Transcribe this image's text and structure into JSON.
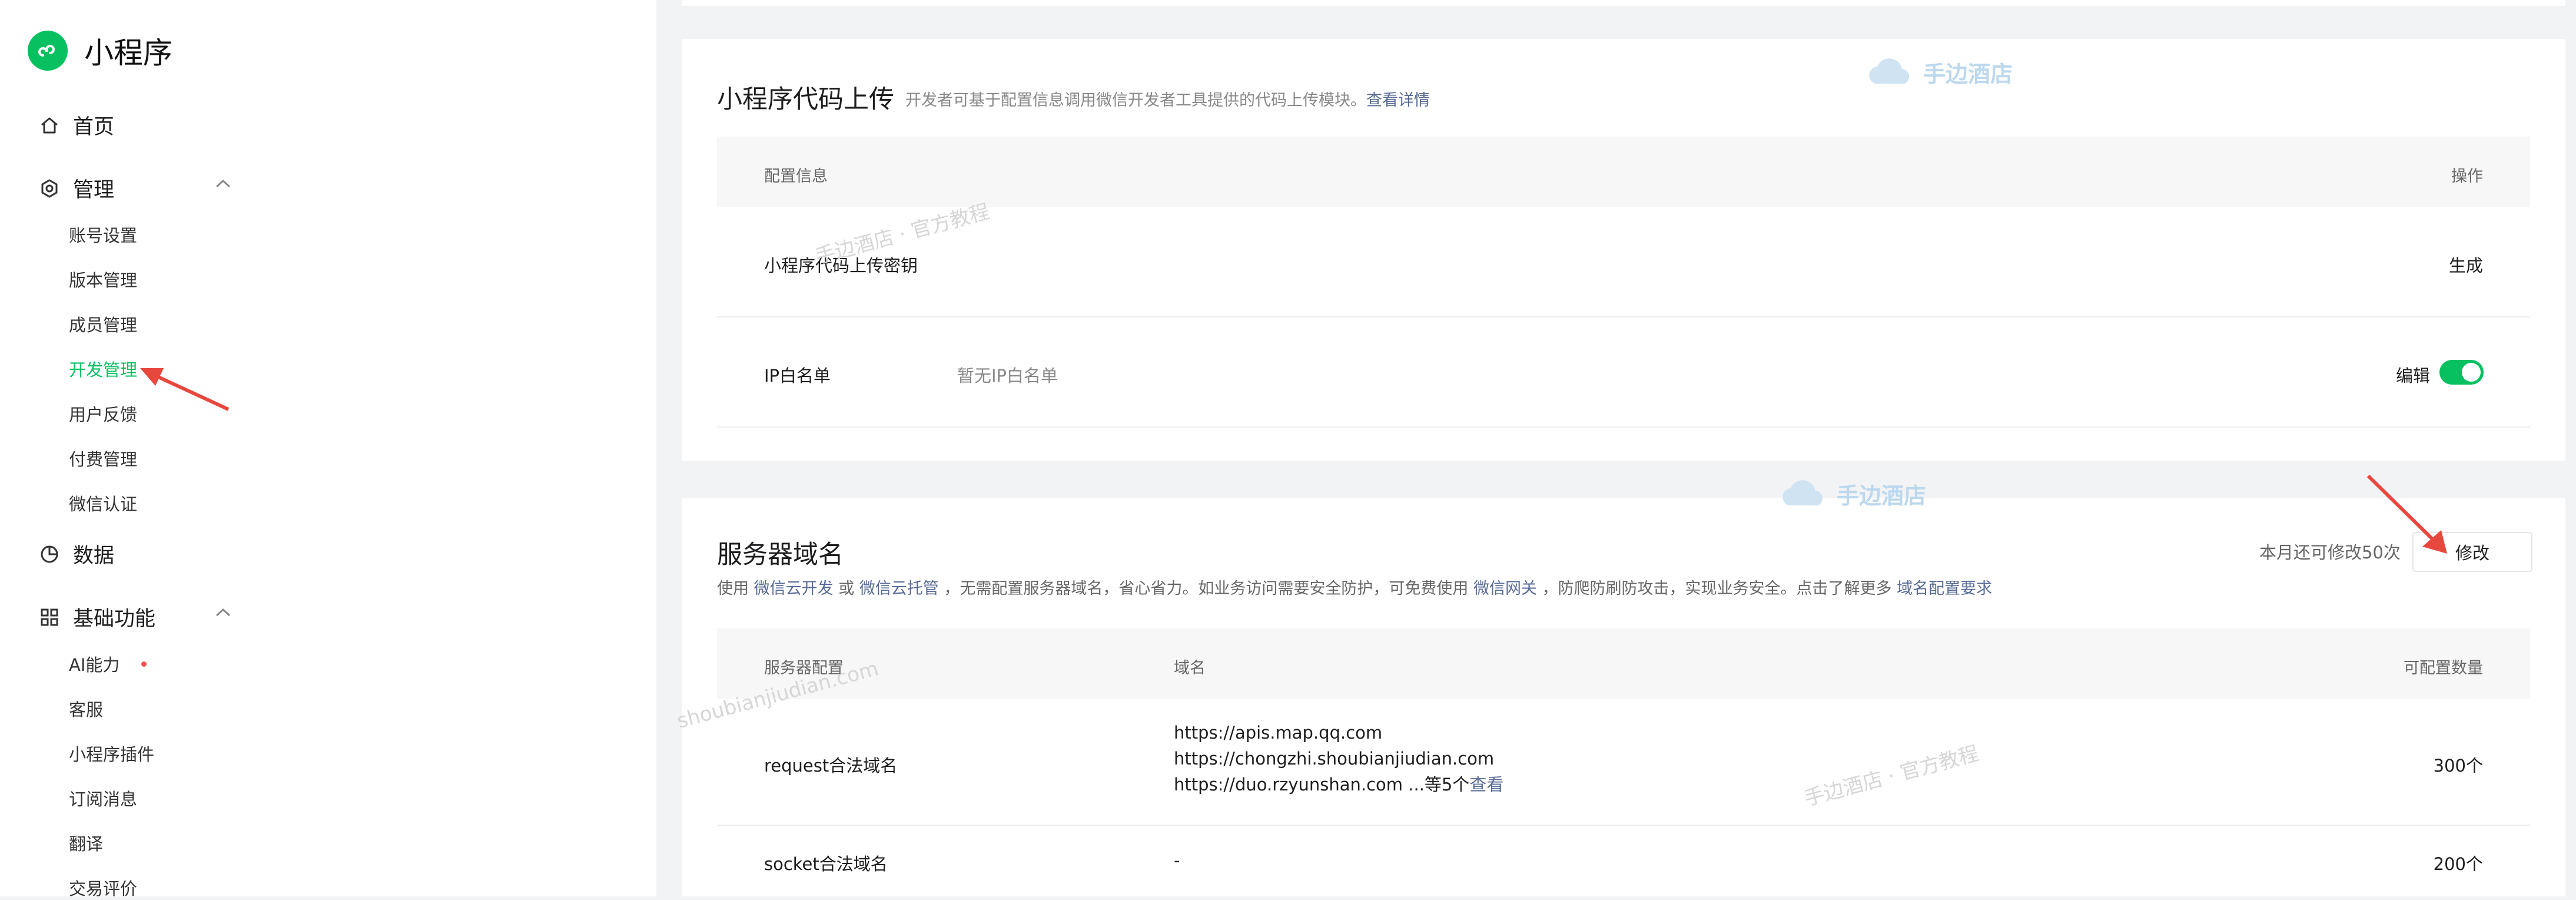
{
  "app": {
    "title": "小程序",
    "brand_color": "#07c160",
    "link_color": "#576b95"
  },
  "sidebar": {
    "home": "首页",
    "manage": {
      "label": "管理",
      "items": [
        "账号设置",
        "版本管理",
        "成员管理",
        "开发管理",
        "用户反馈",
        "付费管理",
        "微信认证"
      ],
      "active_item": "开发管理"
    },
    "data": "数据",
    "basic": {
      "label": "基础功能",
      "items": [
        "AI能力",
        "客服",
        "小程序插件",
        "订阅消息",
        "翻译",
        "交易评价"
      ]
    }
  },
  "upload_card": {
    "title": "小程序代码上传",
    "hint": "开发者可基于配置信息调用微信开发者工具提供的代码上传模块。",
    "hint_link": "查看详情",
    "columns": {
      "config": "配置信息",
      "action": "操作"
    },
    "rows": [
      {
        "label": "小程序代码上传密钥",
        "value": "",
        "action": "生成"
      },
      {
        "label": "IP白名单",
        "value": "暂无IP白名单",
        "action": "编辑",
        "toggle_on": true
      }
    ]
  },
  "domain_card": {
    "title": "服务器域名",
    "quota_text": "本月还可修改50次",
    "modify_button": "修改",
    "desc": {
      "p1": "使用",
      "l1": "微信云开发",
      "p2": "或",
      "l2": "微信云托管",
      "p3": "，无需配置服务器域名，省心省力。如业务访问需要安全防护，可免费使用",
      "l3": "微信网关",
      "p4": "，防爬防刷防攻击，实现业务安全。点击了解更多",
      "l4": "域名配置要求"
    },
    "columns": {
      "config": "服务器配置",
      "domain": "域名",
      "count": "可配置数量"
    },
    "rows": [
      {
        "label": "request合法域名",
        "domains": [
          "https://apis.map.qq.com",
          "https://chongzhi.shoubianjiudian.com",
          "https://duo.rzyunshan.com ...等5个"
        ],
        "view_link": "查看",
        "count": "300个"
      },
      {
        "label": "socket合法域名",
        "domain": "-",
        "count": "200个"
      }
    ]
  },
  "watermarks": {
    "brand": "手边酒店",
    "tutorial": "手边酒店 · 官方教程",
    "domain": "shoubianjiudian.com"
  }
}
